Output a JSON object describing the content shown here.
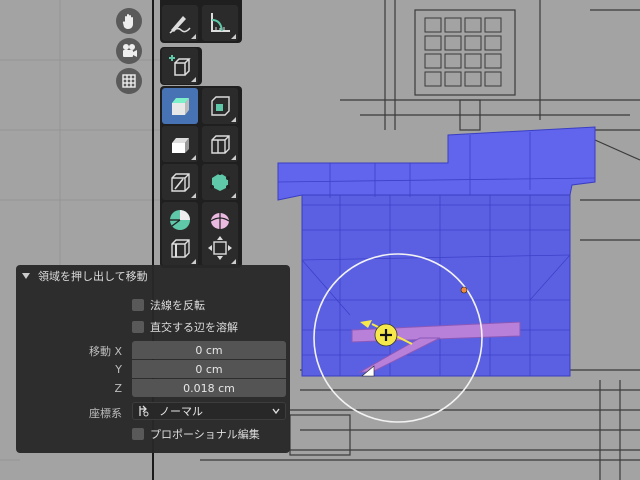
{
  "viewport": {
    "nav_icons": [
      "hand-pan-icon",
      "camera-icon",
      "grid-icon"
    ]
  },
  "toolbar": {
    "tools": [
      "annotate-icon",
      "measure-icon",
      "add-cube-icon",
      "extrude-region-icon",
      "inset-faces-icon",
      "bevel-icon",
      "loop-cut-icon",
      "knife-icon",
      "poly-build-icon",
      "spin-icon",
      "smooth-icon",
      "edge-slide-icon",
      "shrink-fatten-icon"
    ]
  },
  "operator_panel": {
    "title": "領域を押し出して移動",
    "flip_normals_label": "法線を反転",
    "dissolve_ortho_label": "直交する辺を溶解",
    "move_label": "移動 X",
    "y_label": "Y",
    "z_label": "Z",
    "x_value": "0 cm",
    "y_value": "0 cm",
    "z_value": "0.018 cm",
    "orientation_label": "座標系",
    "orientation_value": "ノーマル",
    "proportional_label": "プロポーショナル編集"
  },
  "colors": {
    "mesh": "#5a5fe0",
    "active_tool": "#4772b3",
    "panel_bg": "#282828"
  }
}
